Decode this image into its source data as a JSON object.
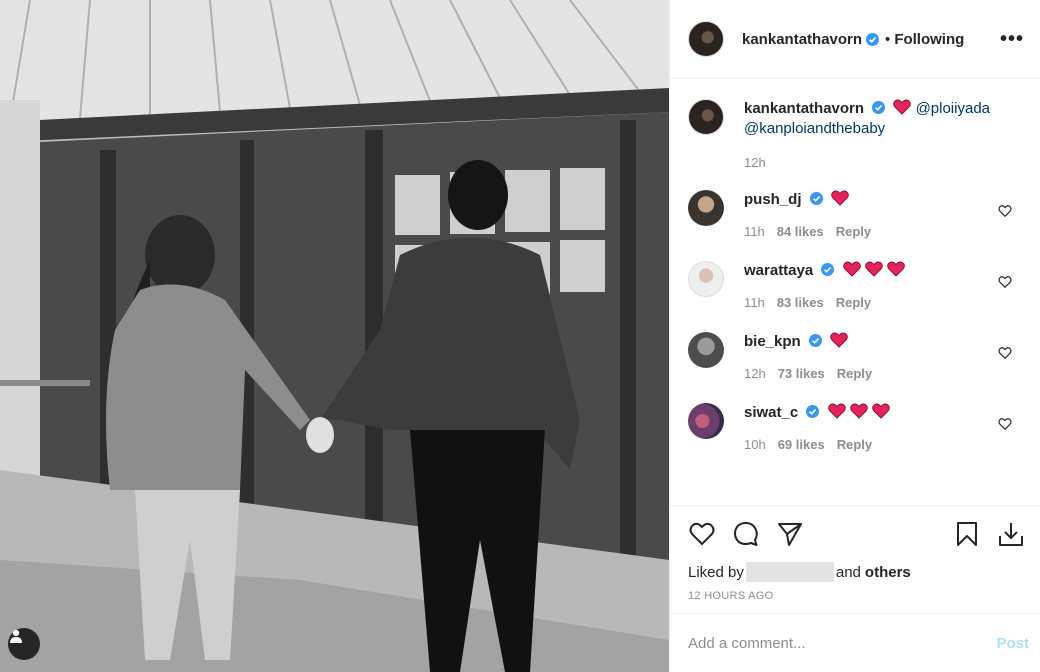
{
  "post": {
    "author": "kankantathavorn",
    "follow_status": "Following",
    "more_label": "•••",
    "dot": "•"
  },
  "caption": {
    "username": "kankantathavorn",
    "mention_1": "@ploiiyada",
    "mention_2": "@kanploiandthebaby",
    "time": "12h"
  },
  "comments": [
    {
      "username": "push_dj",
      "hearts": 1,
      "time": "11h",
      "likes": "84 likes",
      "reply": "Reply"
    },
    {
      "username": "warattaya",
      "hearts": 3,
      "time": "11h",
      "likes": "83 likes",
      "reply": "Reply"
    },
    {
      "username": "bie_kpn",
      "hearts": 1,
      "time": "12h",
      "likes": "73 likes",
      "reply": "Reply"
    },
    {
      "username": "siwat_c",
      "hearts": 3,
      "time": "10h",
      "likes": "69 likes",
      "reply": "Reply"
    }
  ],
  "likes": {
    "prefix": "Liked by",
    "middle": "and",
    "others": "others"
  },
  "time_ago": "12 HOURS AGO",
  "composer": {
    "placeholder": "Add a comment...",
    "post_label": "Post"
  },
  "colors": {
    "verified": "#3897f0",
    "heart_red": "#e0245e",
    "post_disabled": "#b2dffc",
    "link": "#00376b"
  },
  "icons": [
    "user-tag-icon",
    "verified-badge-icon",
    "more-options-icon",
    "heart-icon",
    "comment-icon",
    "share-icon",
    "bookmark-icon",
    "download-icon"
  ]
}
